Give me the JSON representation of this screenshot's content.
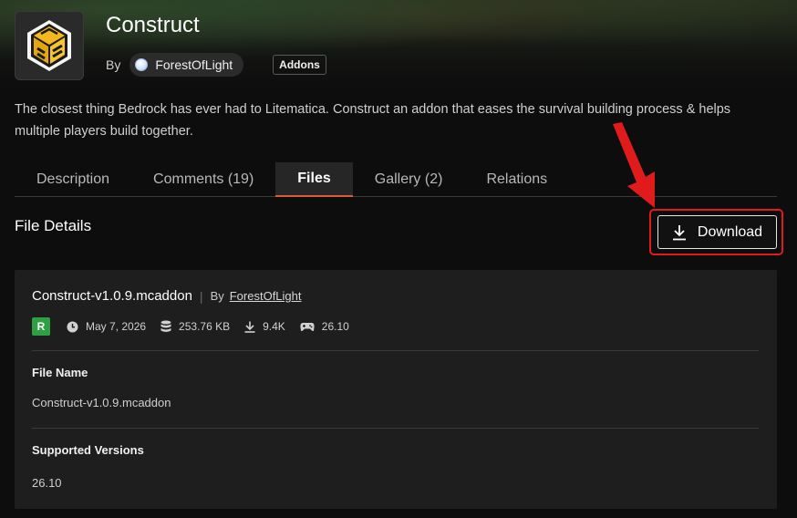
{
  "project": {
    "title": "Construct",
    "by_label": "By",
    "author": "ForestOfLight",
    "category": "Addons",
    "summary": "The closest thing Bedrock has ever had to Litematica. Construct an addon that eases the survival building process & helps multiple players build together.",
    "logo_icon": "construct-block-icon"
  },
  "tabs": [
    {
      "label": "Description",
      "active": false
    },
    {
      "label": "Comments (19)",
      "active": false
    },
    {
      "label": "Files",
      "active": true
    },
    {
      "label": "Gallery (2)",
      "active": false
    },
    {
      "label": "Relations",
      "active": false
    }
  ],
  "file_details": {
    "section_title": "File Details",
    "download_label": "Download",
    "file_name_display": "Construct-v1.0.9.mcaddon",
    "by_label": "By",
    "author": "ForestOfLight",
    "release_type": "R",
    "release_color": "#2ea043",
    "date": "May 7, 2026",
    "size": "253.76 KB",
    "downloads": "9.4K",
    "game_version": "26.10",
    "file_name_label": "File Name",
    "file_name_value": "Construct-v1.0.9.mcaddon",
    "supported_versions_label": "Supported Versions",
    "supported_versions_value": "26.10"
  },
  "annotation": {
    "highlight_color": "#e01b1b"
  }
}
